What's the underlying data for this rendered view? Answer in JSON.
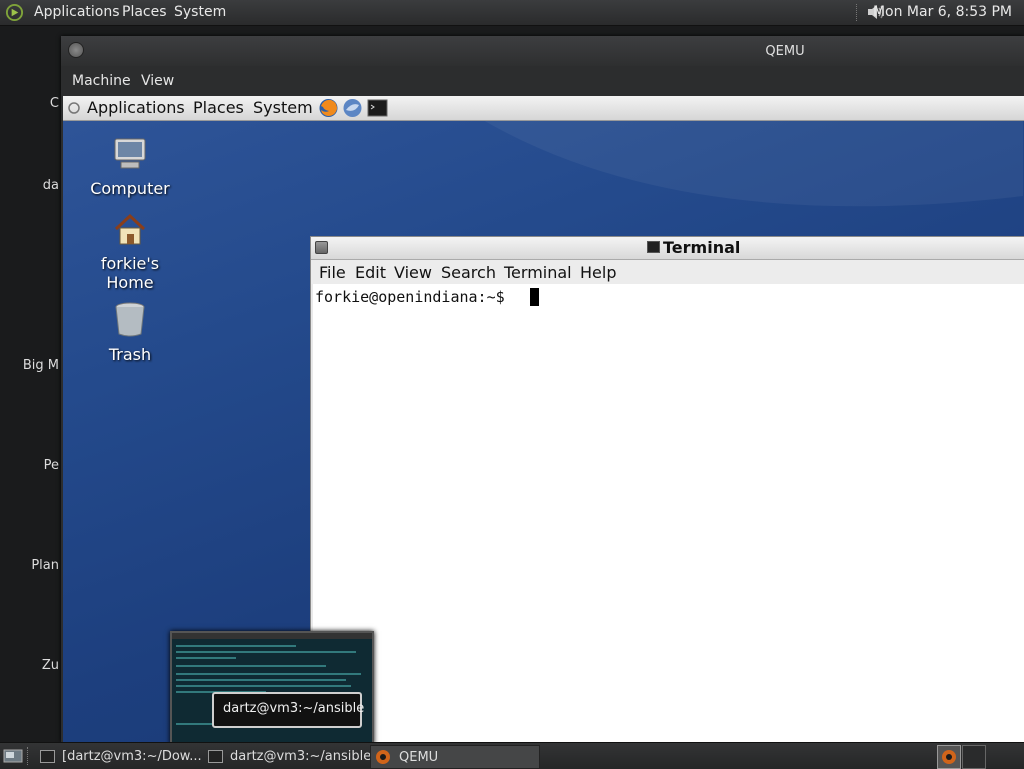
{
  "host_panel": {
    "menus": [
      "Applications",
      "Places",
      "System"
    ],
    "clock": "Mon Mar  6,  8:53 PM"
  },
  "host_desktop": {
    "side_labels": [
      "C",
      "da",
      "Big M",
      "Pe",
      "Plan",
      "Zu"
    ]
  },
  "qemu": {
    "title": "QEMU",
    "menus": [
      "Machine",
      "View"
    ]
  },
  "guest_panel": {
    "menus": [
      "Applications",
      "Places",
      "System"
    ],
    "launchers": [
      "firefox-icon",
      "thunderbird-icon",
      "terminal-icon"
    ]
  },
  "desktop_icons": [
    {
      "label_line1": "Computer",
      "label_line2": "",
      "icon": "computer-icon"
    },
    {
      "label_line1": "forkie's",
      "label_line2": "Home",
      "icon": "home-icon"
    },
    {
      "label_line1": "Trash",
      "label_line2": "",
      "icon": "trash-icon"
    }
  ],
  "terminal": {
    "title": "Terminal",
    "menus": [
      "File",
      "Edit",
      "View",
      "Search",
      "Terminal",
      "Help"
    ],
    "prompt": "forkie@openindiana:~$ "
  },
  "tooltip": {
    "text": "dartz@vm3:~/ansible"
  },
  "taskbar": {
    "tasks": [
      {
        "label": "[dartz@vm3:~/Dow...",
        "active": false
      },
      {
        "label": "dartz@vm3:~/ansible",
        "active": false
      },
      {
        "label": "QEMU",
        "active": true
      }
    ]
  }
}
